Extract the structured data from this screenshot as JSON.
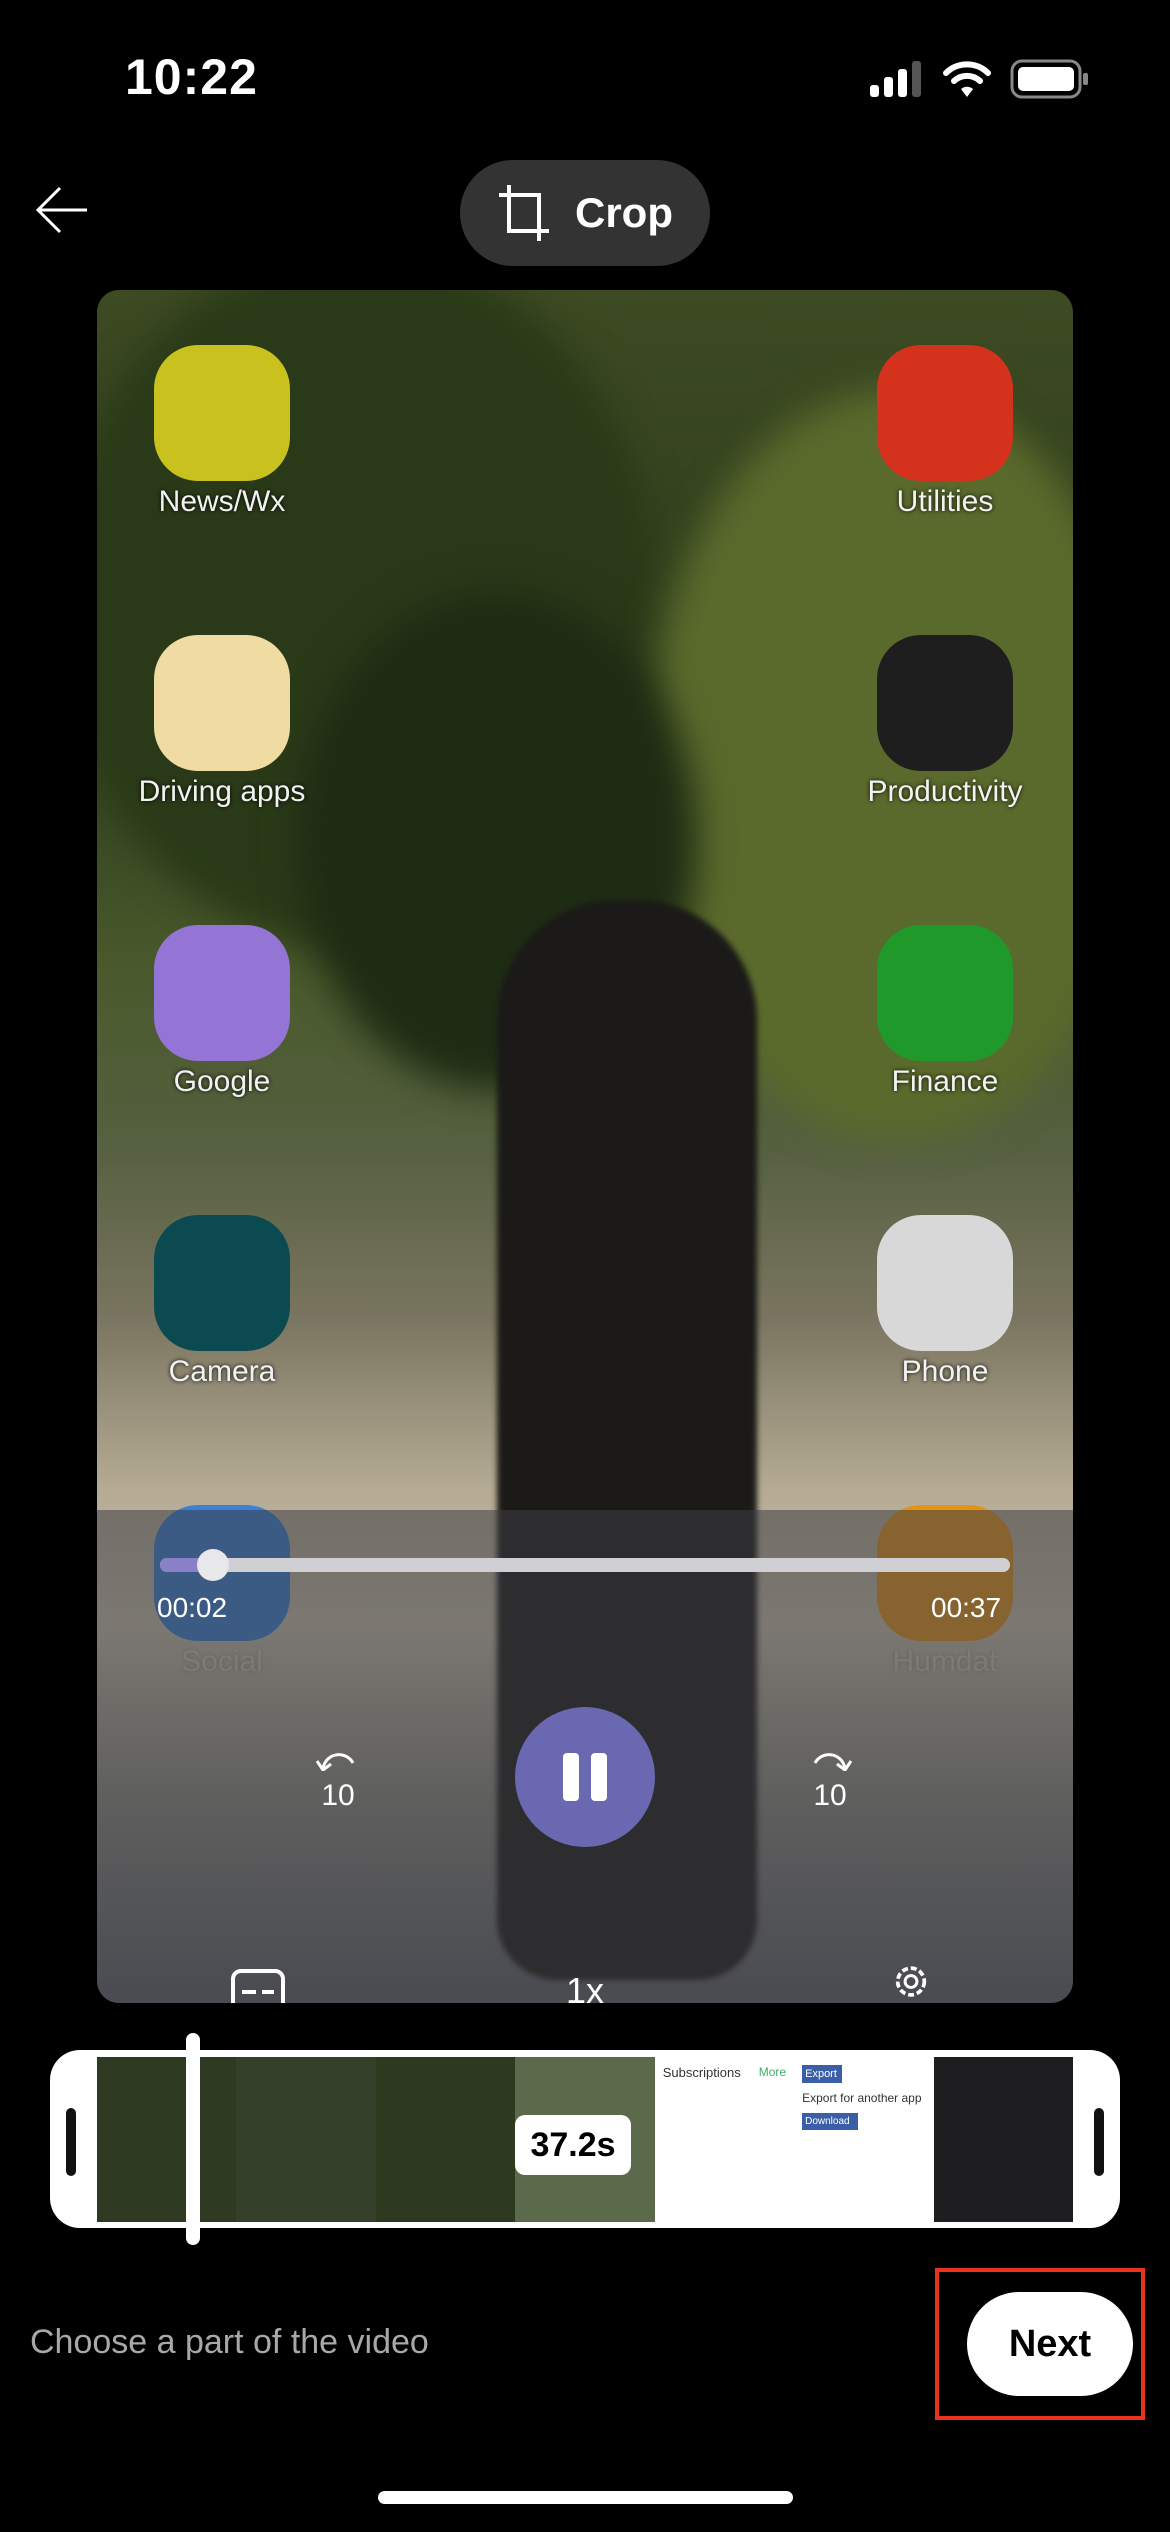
{
  "status_bar": {
    "time": "10:22",
    "signal": "signal-icon",
    "wifi": "wifi-icon",
    "battery": "battery-icon"
  },
  "header": {
    "back_icon": "arrow-left-icon",
    "crop_label": "Crop",
    "crop_icon": "crop-icon"
  },
  "video": {
    "folders": [
      {
        "label": "News/Wx",
        "color": "#c9c21e"
      },
      {
        "label": "Utilities",
        "color": "#d5321e"
      },
      {
        "label": "Driving apps",
        "color": "#f0dca2"
      },
      {
        "label": "Productivity",
        "color": "#1e1e1e"
      },
      {
        "label": "Google",
        "color": "#9474d4"
      },
      {
        "label": "Finance",
        "color": "#1f9a2a"
      },
      {
        "label": "Camera",
        "color": "#0c4a52"
      },
      {
        "label": "Phone",
        "color": "#d8d8d8"
      },
      {
        "label": "Social",
        "color": "#3b82d4"
      },
      {
        "label": "Humdat",
        "color": "#e3921c"
      }
    ],
    "current_time": "00:02",
    "total_time": "00:37",
    "progress_fraction": 0.05,
    "rewind_label": "10",
    "forward_label": "10",
    "speed_label": "1x",
    "accent_color": "#6b68b2"
  },
  "timeline": {
    "duration_label": "37.2s",
    "frames": [
      {
        "tint": "#2f3a22"
      },
      {
        "tint": "#34402a"
      },
      {
        "tint": "#2d3a20"
      },
      {
        "tint": "#5a6a4a"
      },
      {
        "tint": "#ffffff",
        "title": "Subscriptions",
        "more": "More"
      },
      {
        "tint": "#ffffff",
        "button": "Export",
        "heading": "Export for another app",
        "download": "Download"
      },
      {
        "tint": "#1e1e20"
      }
    ]
  },
  "footer": {
    "hint": "Choose a part of the video",
    "next_label": "Next"
  }
}
